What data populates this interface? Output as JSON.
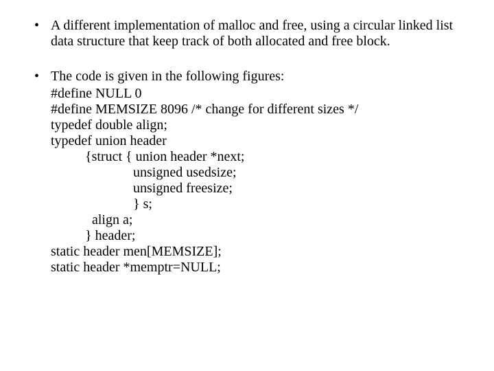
{
  "slide": {
    "bullets": [
      {
        "text": "A different implementation of malloc and free, using a circular linked list data structure that keep track of both allocated and free block."
      },
      {
        "text": "The code is given in the following figures:",
        "code": "#define NULL 0\n#define MEMSIZE 8096 /* change for different sizes */\ntypedef double align;\ntypedef union header\n          {struct { union header *next;\n                        unsigned usedsize;\n                        unsigned freesize;\n                        } s;\n            align a;\n          } header;\nstatic header men[MEMSIZE];\nstatic header *memptr=NULL;"
      }
    ]
  }
}
